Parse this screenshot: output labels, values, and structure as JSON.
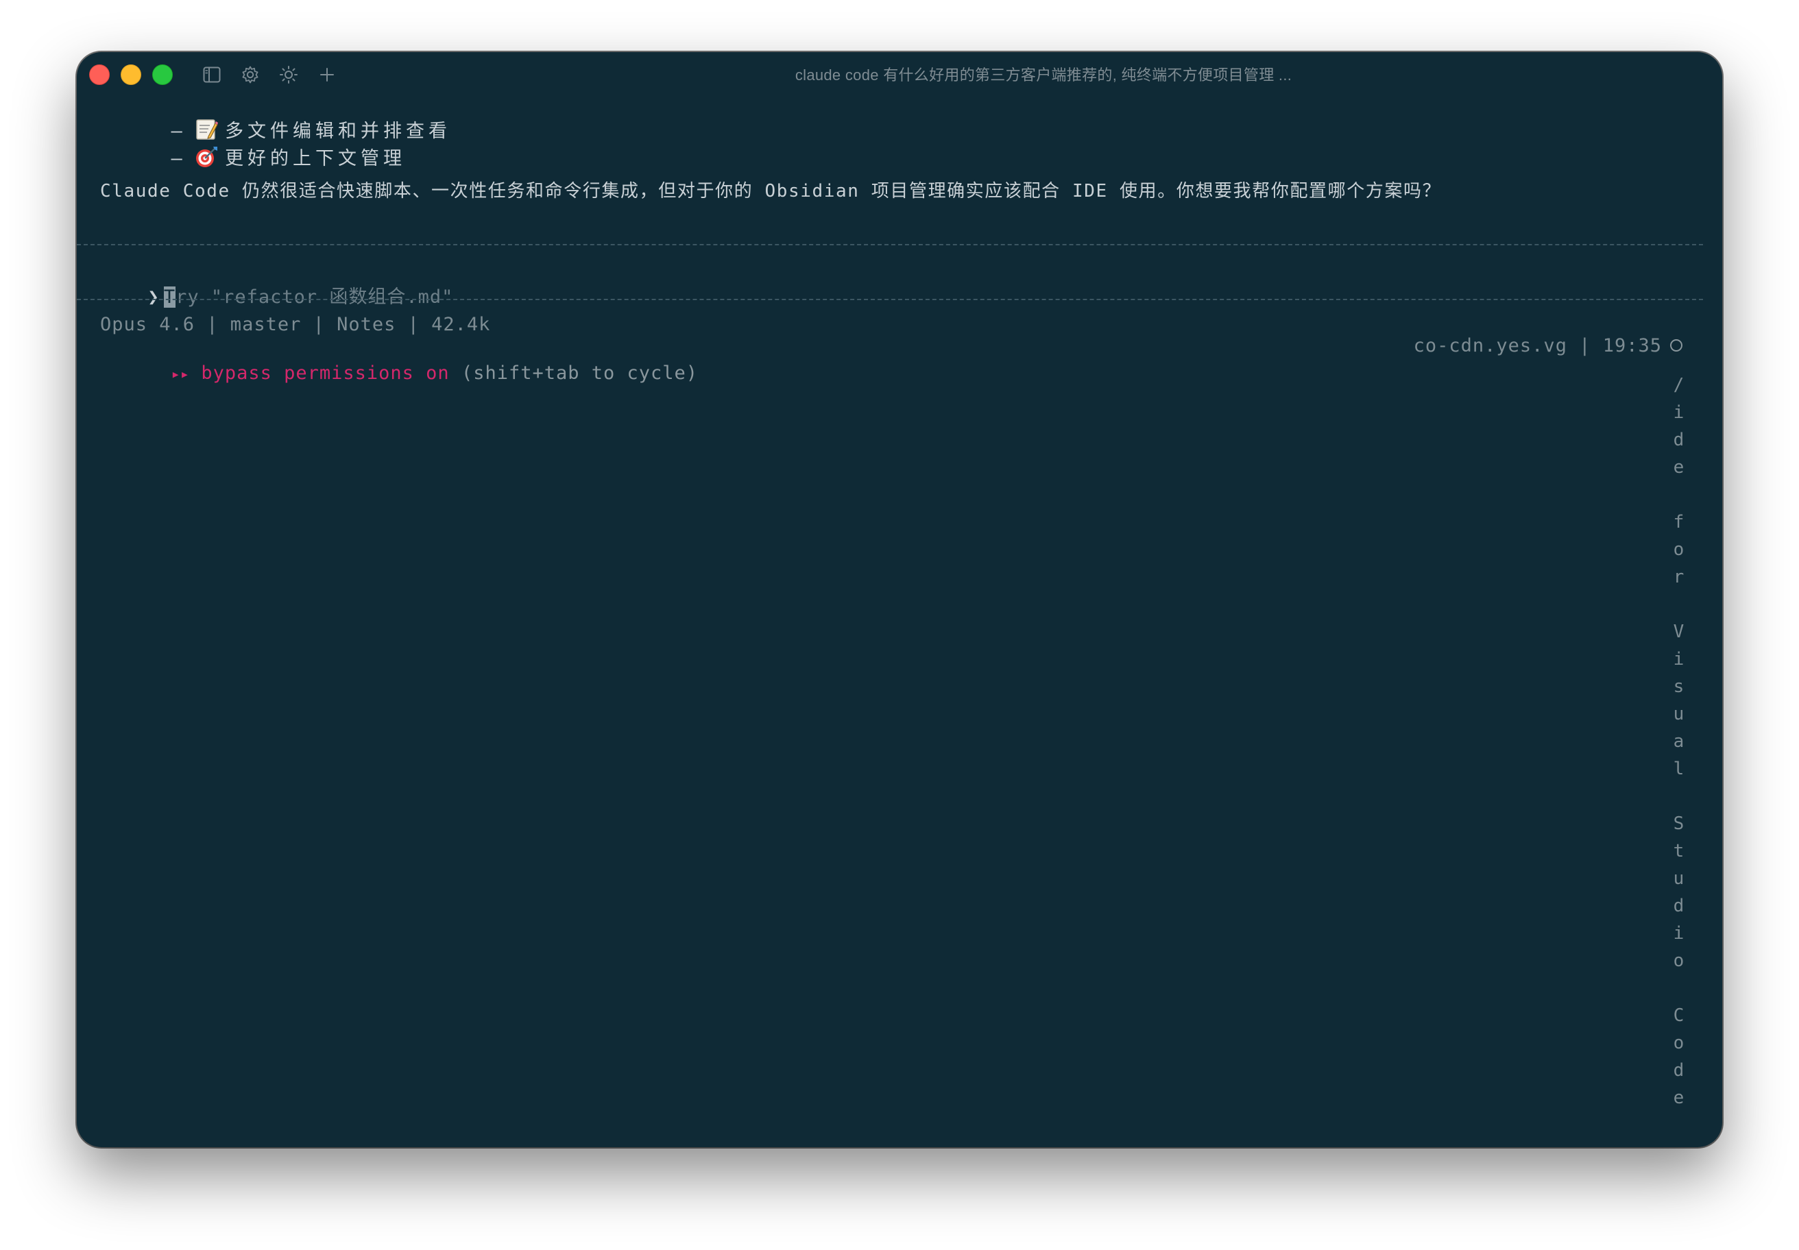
{
  "window": {
    "title": "claude code 有什么好用的第三方客户端推荐的, 纯终端不方便项目管理  ..."
  },
  "titlebar": {
    "icons": [
      "sidebar-toggle-icon",
      "gear-icon",
      "sun-icon",
      "plus-icon"
    ]
  },
  "output": {
    "bullet1_prefix": "– ",
    "bullet1_text": "多文件编辑和并排查看",
    "bullet1_icon": "memo-icon",
    "bullet2_prefix": "– ",
    "bullet2_text": "更好的上下文管理",
    "bullet2_icon": "target-icon",
    "paragraph": "Claude Code 仍然很适合快速脚本、一次性任务和命令行集成，但对于你的 Obsidian 项目管理确实应该配合 IDE 使用。你想要我帮你配置哪个方案吗？"
  },
  "prompt": {
    "caret": "❯",
    "cursor_char": "T",
    "placeholder": "ry \"refactor 函数组合.md\""
  },
  "statusline": {
    "left": "Opus 4.6 | master | Notes | 42.4k",
    "right": "co-cdn.yes.vg | 19:35"
  },
  "mode": {
    "arrows": "▸▸",
    "label": "bypass permissions on",
    "hint": "(shift+tab to cycle)"
  },
  "side_hint": "/ide for Visual Studio Code",
  "colors": {
    "background": "#0f2a36",
    "text": "#c9d1d6",
    "dim": "#7d8c93",
    "accent": "#d4286b"
  }
}
